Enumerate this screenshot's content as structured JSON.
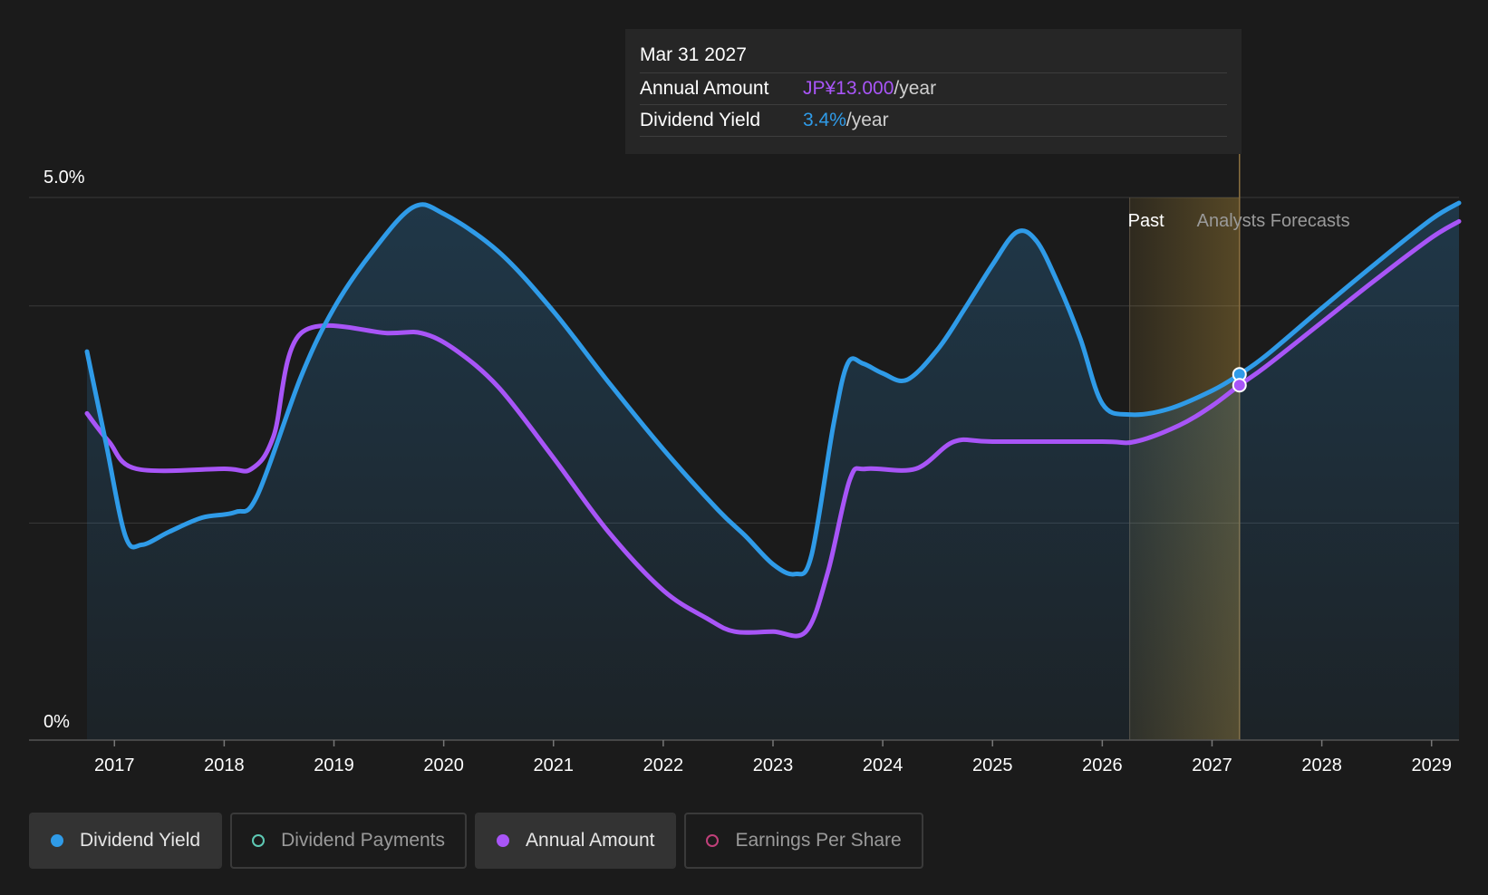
{
  "tooltip": {
    "date": "Mar 31 2027",
    "rows": [
      {
        "label": "Annual Amount",
        "value": "JP¥13.000",
        "unit": "/year"
      },
      {
        "label": "Dividend Yield",
        "value": "3.4%",
        "unit": "/year"
      }
    ]
  },
  "regions": {
    "past_label": "Past",
    "forecast_label": "Analysts Forecasts"
  },
  "legend": [
    {
      "label": "Dividend Yield",
      "color": "#2f9be8",
      "active": true,
      "filled": true
    },
    {
      "label": "Dividend Payments",
      "color": "#5ec9b4",
      "active": false,
      "filled": false
    },
    {
      "label": "Annual Amount",
      "color": "#a855f7",
      "active": true,
      "filled": true
    },
    {
      "label": "Earnings Per Share",
      "color": "#c0407a",
      "active": false,
      "filled": false
    }
  ],
  "colors": {
    "background": "#1b1b1b",
    "yield": "#2f9be8",
    "amount": "#a855f7",
    "grid": "#3a3a3a",
    "forecast_band": "#e0b040"
  },
  "chart_data": {
    "type": "line",
    "title": "",
    "xlabel": "",
    "ylabel": "",
    "xlim": [
      2016.5,
      2029.25
    ],
    "ylim": [
      0,
      5.0
    ],
    "y_tick_labels": [
      {
        "value": 5.0,
        "label": "5.0%"
      },
      {
        "value": 0,
        "label": "0%"
      }
    ],
    "y_gridlines": [
      5.0,
      4.0,
      2.0
    ],
    "x_ticks": [
      2017,
      2018,
      2019,
      2020,
      2021,
      2022,
      2023,
      2024,
      2025,
      2026,
      2027,
      2028,
      2029
    ],
    "past_forecast_boundary": 2026.25,
    "hover_x": 2027.25,
    "series": [
      {
        "name": "Dividend Yield",
        "color": "#2f9be8",
        "points": [
          [
            2016.75,
            3.58
          ],
          [
            2016.92,
            2.75
          ],
          [
            2017.1,
            1.88
          ],
          [
            2017.25,
            1.8
          ],
          [
            2017.5,
            1.92
          ],
          [
            2017.8,
            2.05
          ],
          [
            2018.1,
            2.1
          ],
          [
            2018.3,
            2.25
          ],
          [
            2018.7,
            3.35
          ],
          [
            2019.0,
            3.98
          ],
          [
            2019.35,
            4.5
          ],
          [
            2019.72,
            4.91
          ],
          [
            2020.0,
            4.85
          ],
          [
            2020.5,
            4.5
          ],
          [
            2021.0,
            3.95
          ],
          [
            2021.5,
            3.3
          ],
          [
            2022.0,
            2.68
          ],
          [
            2022.5,
            2.12
          ],
          [
            2022.75,
            1.88
          ],
          [
            2023.0,
            1.62
          ],
          [
            2023.2,
            1.53
          ],
          [
            2023.35,
            1.7
          ],
          [
            2023.55,
            2.9
          ],
          [
            2023.68,
            3.47
          ],
          [
            2023.82,
            3.47
          ],
          [
            2024.0,
            3.38
          ],
          [
            2024.22,
            3.32
          ],
          [
            2024.5,
            3.6
          ],
          [
            2024.75,
            3.98
          ],
          [
            2025.0,
            4.38
          ],
          [
            2025.22,
            4.68
          ],
          [
            2025.4,
            4.6
          ],
          [
            2025.6,
            4.2
          ],
          [
            2025.8,
            3.7
          ],
          [
            2026.0,
            3.1
          ],
          [
            2026.25,
            3.0
          ],
          [
            2026.6,
            3.05
          ],
          [
            2027.0,
            3.22
          ],
          [
            2027.25,
            3.37
          ],
          [
            2027.5,
            3.55
          ],
          [
            2028.0,
            3.98
          ],
          [
            2028.5,
            4.4
          ],
          [
            2029.0,
            4.8
          ],
          [
            2029.25,
            4.95
          ]
        ]
      },
      {
        "name": "Annual Amount",
        "color": "#a855f7",
        "points": [
          [
            2016.75,
            3.01
          ],
          [
            2016.95,
            2.75
          ],
          [
            2017.2,
            2.5
          ],
          [
            2018.0,
            2.5
          ],
          [
            2018.25,
            2.5
          ],
          [
            2018.45,
            2.8
          ],
          [
            2018.7,
            3.75
          ],
          [
            2019.5,
            3.75
          ],
          [
            2019.8,
            3.75
          ],
          [
            2020.1,
            3.6
          ],
          [
            2020.5,
            3.25
          ],
          [
            2021.0,
            2.6
          ],
          [
            2021.5,
            1.92
          ],
          [
            2022.0,
            1.38
          ],
          [
            2022.4,
            1.12
          ],
          [
            2022.65,
            1.0
          ],
          [
            2023.0,
            1.0
          ],
          [
            2023.3,
            1.0
          ],
          [
            2023.5,
            1.55
          ],
          [
            2023.7,
            2.4
          ],
          [
            2023.85,
            2.5
          ],
          [
            2024.3,
            2.5
          ],
          [
            2024.65,
            2.75
          ],
          [
            2025.0,
            2.75
          ],
          [
            2026.0,
            2.75
          ],
          [
            2026.3,
            2.75
          ],
          [
            2026.7,
            2.9
          ],
          [
            2027.0,
            3.08
          ],
          [
            2027.25,
            3.27
          ],
          [
            2027.5,
            3.45
          ],
          [
            2028.0,
            3.85
          ],
          [
            2028.5,
            4.25
          ],
          [
            2029.0,
            4.63
          ],
          [
            2029.25,
            4.78
          ]
        ]
      }
    ]
  }
}
